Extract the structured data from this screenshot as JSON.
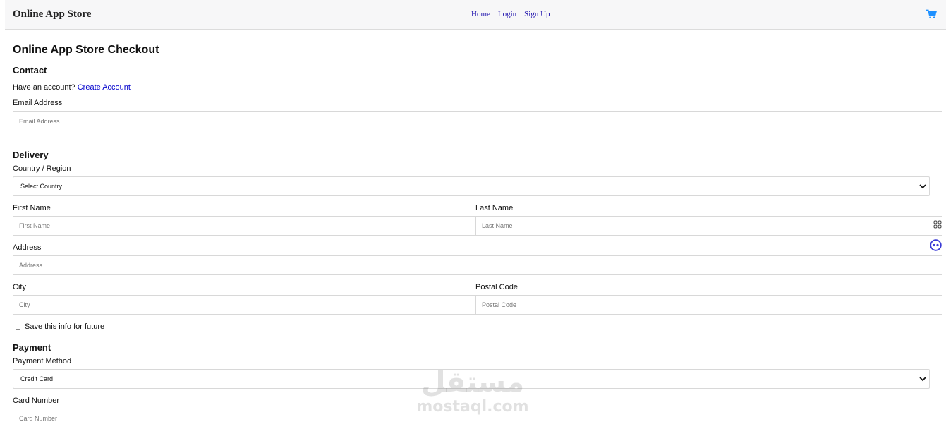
{
  "nav": {
    "brand": "Online App Store",
    "links": [
      "Home",
      "Login",
      "Sign Up"
    ],
    "cart_icon": "cart-icon",
    "accent": "#1e90ff"
  },
  "page": {
    "title": "Online App Store Checkout",
    "contact": {
      "heading": "Contact",
      "account_prompt": "Have an account?",
      "account_link": "Create Account",
      "email_label": "Email Address",
      "email_placeholder": "Email Address"
    },
    "delivery": {
      "heading": "Delivery",
      "country_label": "Country / Region",
      "country_value": "Select Country",
      "first_name_label": "First Name",
      "first_name_placeholder": "First Name",
      "last_name_label": "Last Name",
      "last_name_placeholder": "Last Name",
      "address_label": "Address",
      "address_placeholder": "Address",
      "city_label": "City",
      "city_placeholder": "City",
      "postal_label": "Postal Code",
      "postal_placeholder": "Postal Code",
      "save_info_label": "Save this info for future"
    },
    "payment": {
      "heading": "Payment",
      "method_label": "Payment Method",
      "method_value": "Credit Card",
      "card_number_label": "Card Number",
      "card_number_placeholder": "Card Number"
    }
  },
  "watermark": {
    "arabic": "مستقل",
    "latin": "mostaql.com"
  }
}
